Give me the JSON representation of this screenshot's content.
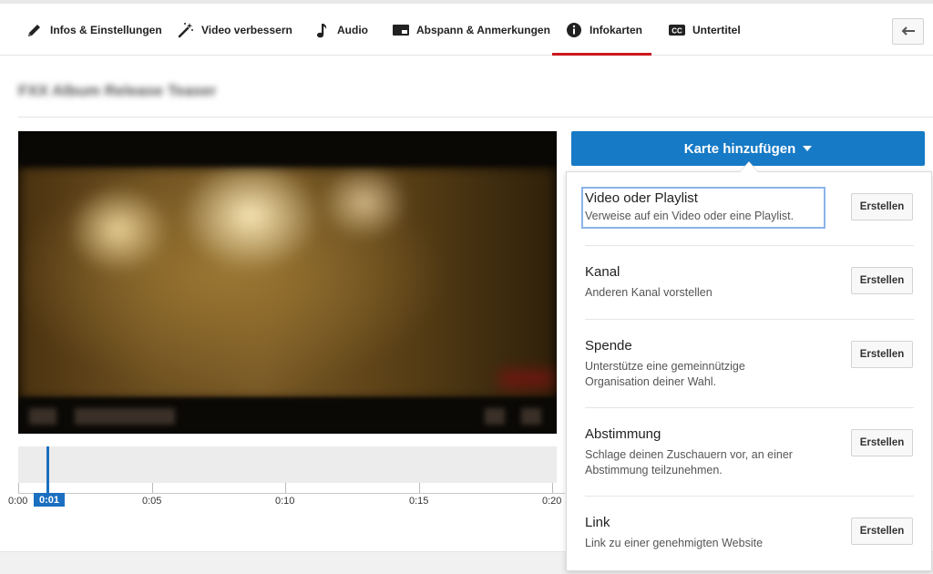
{
  "tabs": [
    {
      "label": "Infos & Einstellungen",
      "icon": "pencil-icon"
    },
    {
      "label": "Video verbessern",
      "icon": "magic-wand-icon"
    },
    {
      "label": "Audio",
      "icon": "music-note-icon"
    },
    {
      "label": "Abspann & Anmerkungen",
      "icon": "end-screen-icon"
    },
    {
      "label": "Infokarten",
      "icon": "info-icon",
      "active": true
    },
    {
      "label": "Untertitel",
      "icon": "cc-icon"
    }
  ],
  "back_icon": "back-arrow-icon",
  "video_title": "FXX Album Release Teaser",
  "timeline": {
    "playhead_label": "0:01",
    "ticks": [
      "0:00",
      "0:05",
      "0:10",
      "0:15",
      "0:20"
    ]
  },
  "add_card_label": "Karte hinzufügen",
  "create_label": "Erstellen",
  "card_types": [
    {
      "title": "Video oder Playlist",
      "desc": "Verweise auf ein Video oder eine Playlist."
    },
    {
      "title": "Kanal",
      "desc": "Anderen Kanal vorstellen"
    },
    {
      "title": "Spende",
      "desc": "Unterstütze eine gemeinnützige Organisation deiner Wahl."
    },
    {
      "title": "Abstimmung",
      "desc": "Schlage deinen Zuschauern vor, an einer Abstimmung teilzunehmen."
    },
    {
      "title": "Link",
      "desc": "Link zu einer genehmigten Website"
    }
  ],
  "colors": {
    "accent": "#167ac6",
    "tab_underline": "#cc181e",
    "playhead": "#1b6fc0"
  }
}
